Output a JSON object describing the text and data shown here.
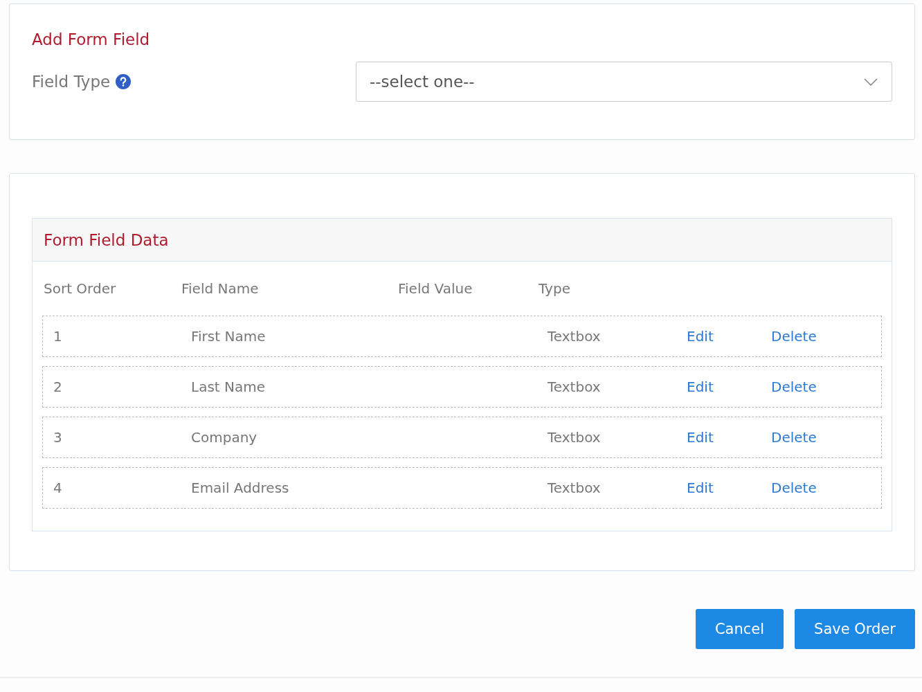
{
  "add_form_field": {
    "title": "Add Form Field",
    "field_type": {
      "label": "Field Type",
      "placeholder": "--select one--"
    }
  },
  "form_field_data": {
    "title": "Form Field Data",
    "columns": [
      "Sort Order",
      "Field Name",
      "Field Value",
      "Type"
    ],
    "rows": [
      {
        "sort_order": "1",
        "field_name": "First Name",
        "type": "Textbox",
        "edit": "Edit",
        "delete": "Delete"
      },
      {
        "sort_order": "2",
        "field_name": "Last Name",
        "type": "Textbox",
        "edit": "Edit",
        "delete": "Delete"
      },
      {
        "sort_order": "3",
        "field_name": "Company",
        "type": "Textbox",
        "edit": "Edit",
        "delete": "Delete"
      },
      {
        "sort_order": "4",
        "field_name": "Email Address",
        "type": "Textbox",
        "edit": "Edit",
        "delete": "Delete"
      }
    ]
  },
  "buttons": [
    "Cancel",
    "Save Order"
  ]
}
